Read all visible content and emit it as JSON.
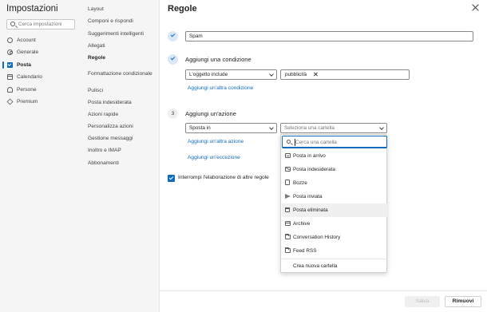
{
  "settings": {
    "title": "Impostazioni",
    "search_placeholder": "Cerca impostazioni",
    "nav": [
      {
        "label": "Account",
        "icon": "account-icon"
      },
      {
        "label": "Generale",
        "icon": "gear-icon"
      },
      {
        "label": "Posta",
        "icon": "mail-icon",
        "active": true
      },
      {
        "label": "Calendario",
        "icon": "calendar-icon"
      },
      {
        "label": "Persone",
        "icon": "people-icon"
      },
      {
        "label": "Premium",
        "icon": "diamond-icon"
      }
    ]
  },
  "subnav": {
    "items": [
      "Layout",
      "Componi e rispondi",
      "Suggerimenti intelligenti",
      "Allegati",
      "Regole",
      "Formattazione condizionale",
      "Pulisci",
      "Posta indesiderata",
      "Azioni rapide",
      "Personalizza azioni",
      "Gestione messaggi",
      "Inoltro e IMAP",
      "Abbonamenti"
    ],
    "active": "Regole"
  },
  "main": {
    "title": "Regole",
    "rule_name": "Spam",
    "condition": {
      "heading": "Aggiungi una condizione",
      "type": "L'oggetto include",
      "tag": "pubblicità",
      "add_link": "Aggiungi un'altra condizione"
    },
    "action": {
      "step": "3",
      "heading": "Aggiungi un'azione",
      "type": "Sposta in",
      "folder_placeholder": "Seleziona una cartella",
      "add_link": "Aggiungi un'altra azione",
      "exception_link": "Aggiungi un'eccezione"
    },
    "stop_processing": {
      "label": "Interrompi l'elaborazione di altre regole",
      "checked": true
    },
    "folder_popup": {
      "search_placeholder": "Cerca una cartella",
      "folders": [
        {
          "label": "Posta in arrivo",
          "icon": "inbox-icon"
        },
        {
          "label": "Posta indesiderata",
          "icon": "junk-icon"
        },
        {
          "label": "Bozze",
          "icon": "draft-icon"
        },
        {
          "label": "Posta inviata",
          "icon": "send-icon"
        },
        {
          "label": "Posta eliminata",
          "icon": "trash-icon",
          "hovered": true
        },
        {
          "label": "Archive",
          "icon": "archive-icon"
        },
        {
          "label": "Conversation History",
          "icon": "folder-icon"
        },
        {
          "label": "Feed RSS",
          "icon": "folder-icon"
        }
      ],
      "create_label": "Crea nuova cartella"
    },
    "buttons": {
      "save": "Salva",
      "discard": "Rimuovi"
    }
  },
  "colors": {
    "accent": "#0f6cbd",
    "panel_bg": "#f5f5f5"
  }
}
